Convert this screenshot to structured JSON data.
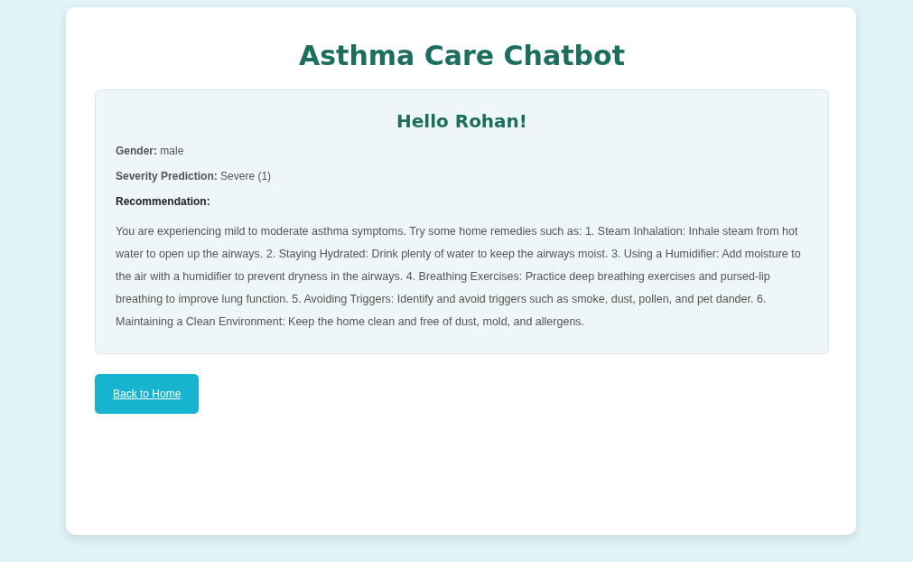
{
  "title": "Asthma Care Chatbot",
  "greeting": "Hello Rohan!",
  "details": [
    "**Gender:** male",
    "**Severity Prediction:** Severe (1)"
  ],
  "recommendation": {
    "label": "Recommendation:",
    "text": "You are experiencing mild to moderate asthma symptoms. Try some home remedies such as: 1. Steam Inhalation: Inhale steam from hot water to open up the airways. 2. Staying Hydrated: Drink plenty of water to keep the airways moist. 3. Using a Humidifier: Add moisture to the air with a humidifier to prevent dryness in the airways. 4. Breathing Exercises: Practice deep breathing exercises and pursed-lip breathing to improve lung function. 5. Avoiding Triggers: Identify and avoid triggers such as smoke, dust, pollen, and pet dander. 6. Maintaining a Clean Environment: Keep the home clean and free of dust, mold, and allergens."
  },
  "button": "Back to Home"
}
